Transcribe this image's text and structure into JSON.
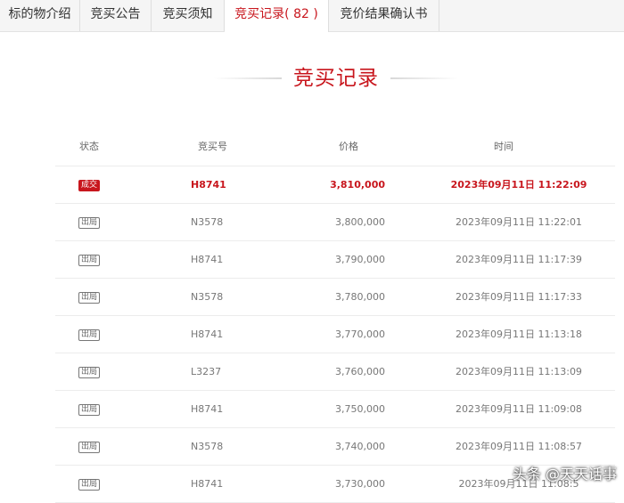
{
  "tabs": [
    {
      "label": "标的物介绍"
    },
    {
      "label": "竞买公告"
    },
    {
      "label": "竞买须知"
    },
    {
      "label": "竞买记录",
      "count": "( 82 )"
    },
    {
      "label": "竞价结果确认书"
    }
  ],
  "section_title": "竞买记录",
  "table": {
    "headers": [
      "状态",
      "竞买号",
      "价格",
      "时间"
    ],
    "rows": [
      {
        "status": "成交",
        "bid": "H8741",
        "price": "3,810,000",
        "time": "2023年09月11日 11:22:09"
      },
      {
        "status": "出局",
        "bid": "N3578",
        "price": "3,800,000",
        "time": "2023年09月11日 11:22:01"
      },
      {
        "status": "出局",
        "bid": "H8741",
        "price": "3,790,000",
        "time": "2023年09月11日 11:17:39"
      },
      {
        "status": "出局",
        "bid": "N3578",
        "price": "3,780,000",
        "time": "2023年09月11日 11:17:33"
      },
      {
        "status": "出局",
        "bid": "H8741",
        "price": "3,770,000",
        "time": "2023年09月11日 11:13:18"
      },
      {
        "status": "出局",
        "bid": "L3237",
        "price": "3,760,000",
        "time": "2023年09月11日 11:13:09"
      },
      {
        "status": "出局",
        "bid": "H8741",
        "price": "3,750,000",
        "time": "2023年09月11日 11:09:08"
      },
      {
        "status": "出局",
        "bid": "N3578",
        "price": "3,740,000",
        "time": "2023年09月11日 11:08:57"
      },
      {
        "status": "出局",
        "bid": "H8741",
        "price": "3,730,000",
        "time": "2023年09月11日 11:08:5"
      }
    ]
  },
  "watermark": "头条 @天天话事",
  "colors": {
    "accent": "#c8161d",
    "tab_bar": "#f5f5f5"
  }
}
